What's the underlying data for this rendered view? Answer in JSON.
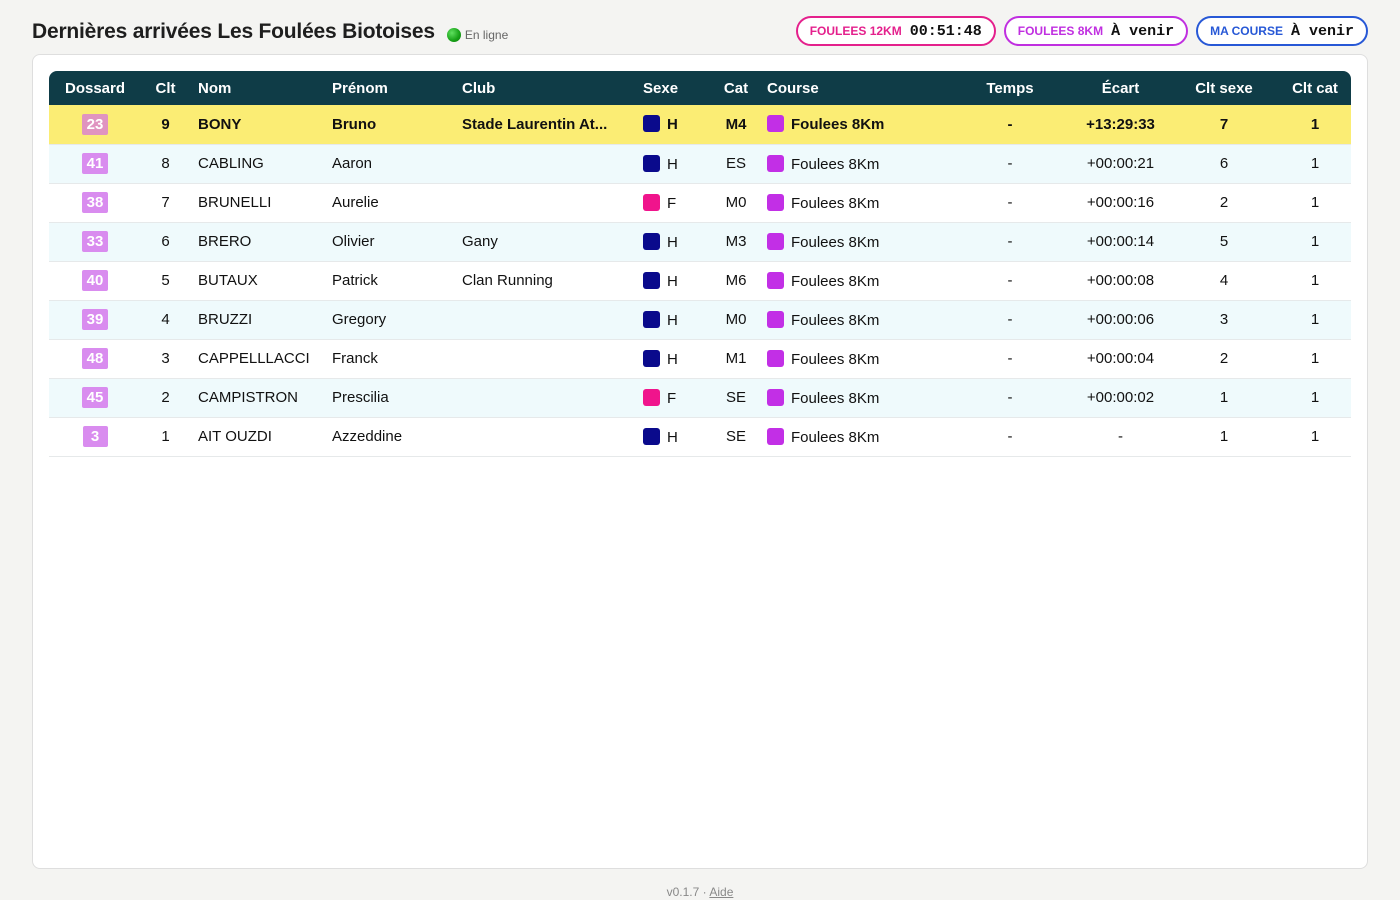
{
  "header": {
    "title": "Dernières arrivées Les Foulées Biotoises",
    "status_label": "En ligne",
    "status_color": "#16a016"
  },
  "races": [
    {
      "name": "FOULEES 12KM",
      "value": "00:51:48",
      "color": "#e4208c"
    },
    {
      "name": "FOULEES 8KM",
      "value": "À venir",
      "color": "#c02fe0"
    },
    {
      "name": "MA COURSE",
      "value": "À venir",
      "color": "#2758d6"
    }
  ],
  "table": {
    "columns": [
      "Dossard",
      "Clt",
      "Nom",
      "Prénom",
      "Club",
      "Sexe",
      "Cat",
      "Course",
      "Temps",
      "Écart",
      "Clt sexe",
      "Clt cat"
    ],
    "rows": [
      {
        "bib": "23",
        "rank": "9",
        "last": "BONY",
        "first": "Bruno",
        "club": "Stade Laurentin At...",
        "sex": "H",
        "cat": "M4",
        "course": "Foulees 8Km",
        "time": "-",
        "gap": "+13:29:33",
        "rank_sex": "7",
        "rank_cat": "1",
        "highlight": true
      },
      {
        "bib": "41",
        "rank": "8",
        "last": "CABLING",
        "first": "Aaron",
        "club": "",
        "sex": "H",
        "cat": "ES",
        "course": "Foulees 8Km",
        "time": "-",
        "gap": "+00:00:21",
        "rank_sex": "6",
        "rank_cat": "1"
      },
      {
        "bib": "38",
        "rank": "7",
        "last": "BRUNELLI",
        "first": "Aurelie",
        "club": "",
        "sex": "F",
        "cat": "M0",
        "course": "Foulees 8Km",
        "time": "-",
        "gap": "+00:00:16",
        "rank_sex": "2",
        "rank_cat": "1"
      },
      {
        "bib": "33",
        "rank": "6",
        "last": "BRERO",
        "first": "Olivier",
        "club": "Gany",
        "sex": "H",
        "cat": "M3",
        "course": "Foulees 8Km",
        "time": "-",
        "gap": "+00:00:14",
        "rank_sex": "5",
        "rank_cat": "1"
      },
      {
        "bib": "40",
        "rank": "5",
        "last": "BUTAUX",
        "first": "Patrick",
        "club": "Clan Running",
        "sex": "H",
        "cat": "M6",
        "course": "Foulees 8Km",
        "time": "-",
        "gap": "+00:00:08",
        "rank_sex": "4",
        "rank_cat": "1"
      },
      {
        "bib": "39",
        "rank": "4",
        "last": "BRUZZI",
        "first": "Gregory",
        "club": "",
        "sex": "H",
        "cat": "M0",
        "course": "Foulees 8Km",
        "time": "-",
        "gap": "+00:00:06",
        "rank_sex": "3",
        "rank_cat": "1"
      },
      {
        "bib": "48",
        "rank": "3",
        "last": "CAPPELLLACCI",
        "first": "Franck",
        "club": "",
        "sex": "H",
        "cat": "M1",
        "course": "Foulees 8Km",
        "time": "-",
        "gap": "+00:00:04",
        "rank_sex": "2",
        "rank_cat": "1"
      },
      {
        "bib": "45",
        "rank": "2",
        "last": "CAMPISTRON",
        "first": "Prescilia",
        "club": "",
        "sex": "F",
        "cat": "SE",
        "course": "Foulees 8Km",
        "time": "-",
        "gap": "+00:00:02",
        "rank_sex": "1",
        "rank_cat": "1"
      },
      {
        "bib": "3",
        "rank": "1",
        "last": "AIT OUZDI",
        "first": "Azzeddine",
        "club": "",
        "sex": "H",
        "cat": "SE",
        "course": "Foulees 8Km",
        "time": "-",
        "gap": "-",
        "rank_sex": "1",
        "rank_cat": "1"
      }
    ]
  },
  "colors": {
    "sex_H": "#0a0a8c",
    "sex_F": "#f0148c",
    "course_8km": "#c22fe6"
  },
  "footer": {
    "version": "v0.1.7",
    "separator": "·",
    "help_link": "Aide"
  }
}
